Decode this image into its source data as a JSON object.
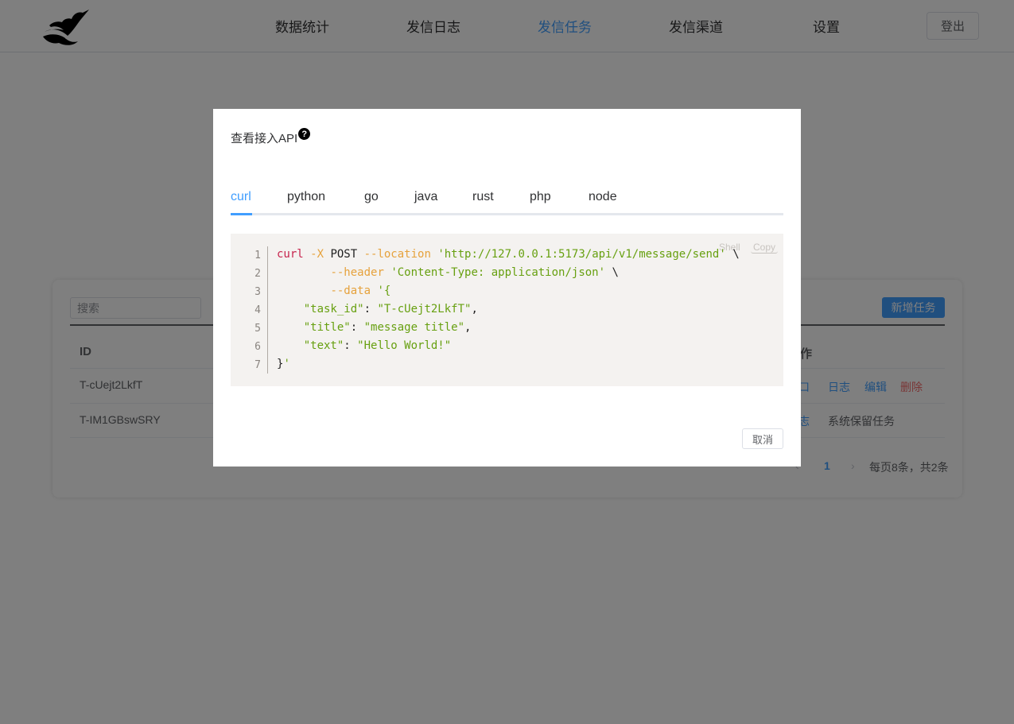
{
  "nav": {
    "items": [
      {
        "label": "数据统计"
      },
      {
        "label": "发信日志"
      },
      {
        "label": "发信任务"
      },
      {
        "label": "发信渠道"
      },
      {
        "label": "设置"
      }
    ],
    "active_index": 2,
    "logout_label": "登出"
  },
  "task_page": {
    "search_placeholder": "搜索",
    "add_label": "新增任务",
    "columns": {
      "id": "ID",
      "actions": "作"
    },
    "rows": [
      {
        "id": "T-cUejt2LkfT",
        "actions": [
          "口",
          "日志",
          "编辑",
          "删除"
        ]
      },
      {
        "id": "T-IM1GBswSRY",
        "actions": [
          "志"
        ],
        "note": "系统保留任务"
      }
    ],
    "pagination": {
      "current": "1",
      "summary": "每页8条，共2条"
    }
  },
  "modal": {
    "title": "查看接入API",
    "help_icon": "question-circle-icon",
    "tabs": [
      "curl",
      "python",
      "go",
      "java",
      "rust",
      "php",
      "node"
    ],
    "active_tab": 0,
    "code": {
      "lang_badge": "Shell",
      "copy_label": "Copy",
      "line_numbers": [
        "1",
        "2",
        "3",
        "4",
        "5",
        "6",
        "7"
      ],
      "lines": [
        "curl -X POST --location 'http://127.0.0.1:5173/api/v1/message/send' \\",
        "        --header 'Content-Type: application/json' \\",
        "        --data '{",
        "    \"task_id\": \"T-cUejt2LkfT\",",
        "    \"title\": \"message title\",",
        "    \"text\": \"Hello World!\"",
        "}'"
      ]
    },
    "cancel_label": "取消"
  },
  "colors": {
    "accent": "#409eff",
    "danger": "#f56c6c",
    "overlay": "rgba(0,0,0,0.5)"
  }
}
